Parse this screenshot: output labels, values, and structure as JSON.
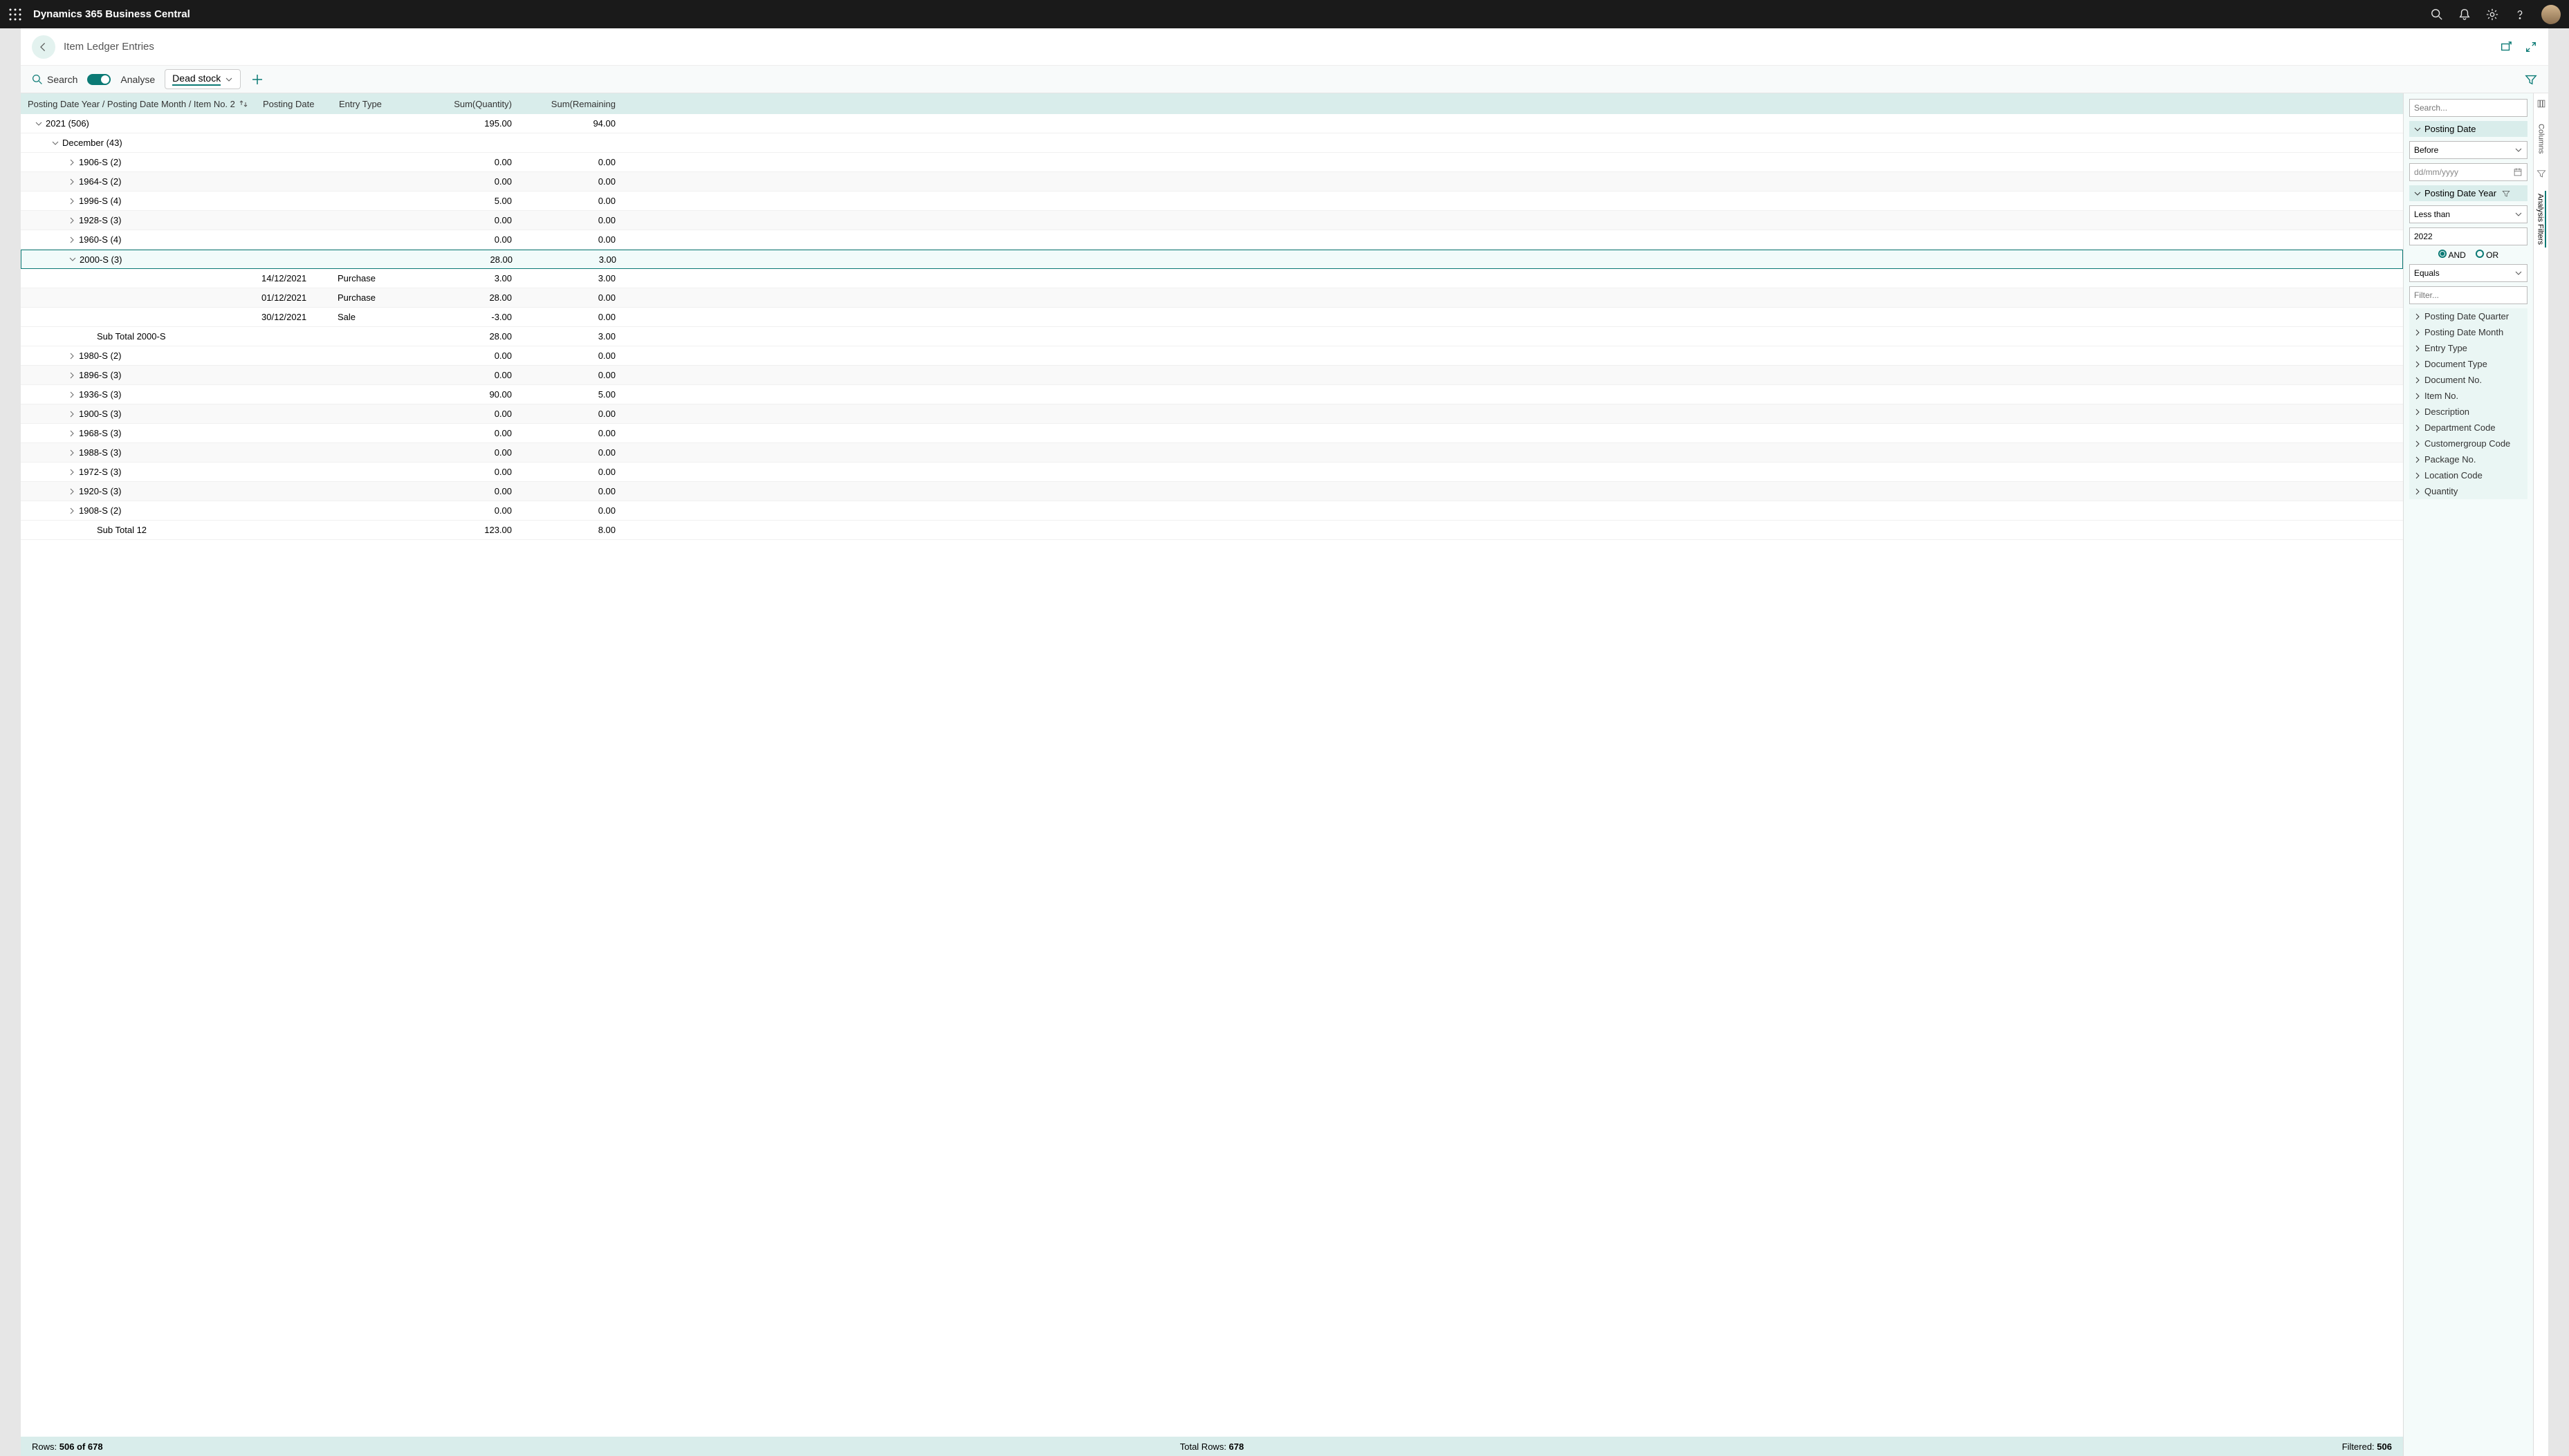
{
  "app": {
    "title": "Dynamics 365 Business Central"
  },
  "page": {
    "title": "Item Ledger Entries"
  },
  "toolbar": {
    "search_label": "Search",
    "analyse_label": "Analyse",
    "tab_label": "Dead stock"
  },
  "columns": {
    "group_header": "Posting Date Year / Posting Date Month / Item No. 2",
    "posting_date": "Posting Date",
    "entry_type": "Entry Type",
    "sum_quantity": "Sum(Quantity)",
    "sum_remaining": "Sum(Remaining"
  },
  "rows": [
    {
      "kind": "year",
      "label": "2021 (506)",
      "qty": "195.00",
      "rem": "94.00"
    },
    {
      "kind": "month",
      "label": "December (43)"
    },
    {
      "kind": "item",
      "label": "1906-S (2)",
      "qty": "0.00",
      "rem": "0.00",
      "alt": false
    },
    {
      "kind": "item",
      "label": "1964-S (2)",
      "qty": "0.00",
      "rem": "0.00",
      "alt": true
    },
    {
      "kind": "item",
      "label": "1996-S (4)",
      "qty": "5.00",
      "rem": "0.00",
      "alt": false
    },
    {
      "kind": "item",
      "label": "1928-S (3)",
      "qty": "0.00",
      "rem": "0.00",
      "alt": true
    },
    {
      "kind": "item",
      "label": "1960-S (4)",
      "qty": "0.00",
      "rem": "0.00",
      "alt": false
    },
    {
      "kind": "item_open",
      "label": "2000-S (3)",
      "qty": "28.00",
      "rem": "3.00",
      "sel": true
    },
    {
      "kind": "entry",
      "date": "14/12/2021",
      "etype": "Purchase",
      "qty": "3.00",
      "rem": "3.00",
      "alt": false
    },
    {
      "kind": "entry",
      "date": "01/12/2021",
      "etype": "Purchase",
      "qty": "28.00",
      "rem": "0.00",
      "alt": true
    },
    {
      "kind": "entry",
      "date": "30/12/2021",
      "etype": "Sale",
      "qty": "-3.00",
      "rem": "0.00",
      "alt": false
    },
    {
      "kind": "subtotal",
      "label": "Sub Total 2000-S",
      "qty": "28.00",
      "rem": "3.00"
    },
    {
      "kind": "item",
      "label": "1980-S (2)",
      "qty": "0.00",
      "rem": "0.00",
      "alt": false
    },
    {
      "kind": "item",
      "label": "1896-S (3)",
      "qty": "0.00",
      "rem": "0.00",
      "alt": true
    },
    {
      "kind": "item",
      "label": "1936-S (3)",
      "qty": "90.00",
      "rem": "5.00",
      "alt": false
    },
    {
      "kind": "item",
      "label": "1900-S (3)",
      "qty": "0.00",
      "rem": "0.00",
      "alt": true
    },
    {
      "kind": "item",
      "label": "1968-S (3)",
      "qty": "0.00",
      "rem": "0.00",
      "alt": false
    },
    {
      "kind": "item",
      "label": "1988-S (3)",
      "qty": "0.00",
      "rem": "0.00",
      "alt": true
    },
    {
      "kind": "item",
      "label": "1972-S (3)",
      "qty": "0.00",
      "rem": "0.00",
      "alt": false
    },
    {
      "kind": "item",
      "label": "1920-S (3)",
      "qty": "0.00",
      "rem": "0.00",
      "alt": true
    },
    {
      "kind": "item",
      "label": "1908-S (2)",
      "qty": "0.00",
      "rem": "0.00",
      "alt": false
    },
    {
      "kind": "subtotal",
      "label": "Sub Total 12",
      "qty": "123.00",
      "rem": "8.00"
    }
  ],
  "statusbar": {
    "rows_label": "Rows: ",
    "rows_value": "506 of 678",
    "total_label": "Total Rows: ",
    "total_value": "678",
    "filtered_label": "Filtered: ",
    "filtered_value": "506"
  },
  "side": {
    "search_placeholder": "Search...",
    "posting_date": "Posting Date",
    "before": "Before",
    "date_placeholder": "dd/mm/yyyy",
    "posting_date_year": "Posting Date Year",
    "less_than": "Less than",
    "year_value": "2022",
    "and": "AND",
    "or": "OR",
    "equals": "Equals",
    "filter_placeholder": "Filter...",
    "collapsed": [
      "Posting Date Quarter",
      "Posting Date Month",
      "Entry Type",
      "Document Type",
      "Document No.",
      "Item No.",
      "Description",
      "Department Code",
      "Customergroup Code",
      "Package No.",
      "Location Code",
      "Quantity"
    ]
  },
  "vtabs": {
    "columns": "Columns",
    "filters": "Analysis Filters"
  }
}
